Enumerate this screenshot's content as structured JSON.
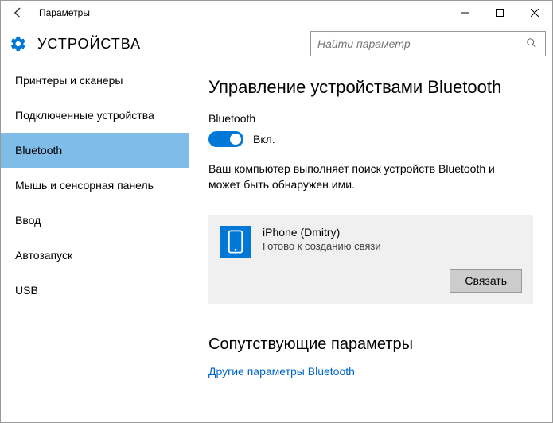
{
  "window": {
    "title": "Параметры"
  },
  "header": {
    "page_title": "УСТРОЙСТВА",
    "search_placeholder": "Найти параметр"
  },
  "sidebar": {
    "items": [
      {
        "label": "Принтеры и сканеры",
        "selected": false
      },
      {
        "label": "Подключенные устройства",
        "selected": false
      },
      {
        "label": "Bluetooth",
        "selected": true
      },
      {
        "label": "Мышь и сенсорная панель",
        "selected": false
      },
      {
        "label": "Ввод",
        "selected": false
      },
      {
        "label": "Автозапуск",
        "selected": false
      },
      {
        "label": "USB",
        "selected": false
      }
    ]
  },
  "main": {
    "section_title": "Управление устройствами Bluetooth",
    "toggle_group": "Bluetooth",
    "toggle_state": "Вкл.",
    "description": "Ваш компьютер выполняет поиск устройств Bluetooth и может быть обнаружен ими.",
    "device": {
      "name": "iPhone (Dmitry)",
      "status": "Готово к созданию связи",
      "action": "Связать"
    },
    "related_title": "Сопутствующие параметры",
    "related_link": "Другие параметры Bluetooth"
  }
}
